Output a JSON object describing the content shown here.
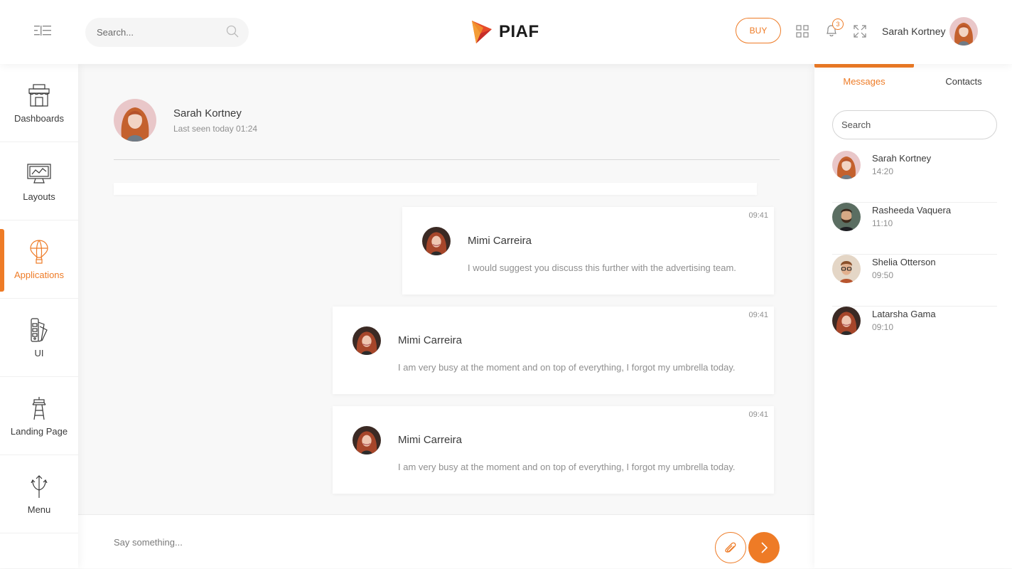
{
  "colors": {
    "accent": "#ee7b26",
    "background": "#f8f8f8"
  },
  "header": {
    "search_placeholder": "Search...",
    "brand": "PIAF",
    "buy_label": "BUY",
    "notification_count": "3",
    "user_name": "Sarah Kortney",
    "icons": [
      "menu-toggle-icon",
      "search-icon",
      "apps-grid-icon",
      "bell-icon",
      "fullscreen-icon"
    ]
  },
  "sidebar": {
    "items": [
      {
        "label": "Dashboards",
        "icon": "shop-icon"
      },
      {
        "label": "Layouts",
        "icon": "monitor-chart-icon"
      },
      {
        "label": "Applications",
        "icon": "air-balloon-icon",
        "active": true
      },
      {
        "label": "UI",
        "icon": "pantone-icon"
      },
      {
        "label": "Landing Page",
        "icon": "tower-icon"
      },
      {
        "label": "Menu",
        "icon": "three-arrows-icon"
      }
    ]
  },
  "chat": {
    "contact_name": "Sarah Kortney",
    "last_seen": "Last seen today 01:24",
    "messages": [
      {
        "sender": "Mimi Carreira",
        "time": "09:41",
        "text": "I would suggest you discuss this further with the advertising team."
      },
      {
        "sender": "Mimi Carreira",
        "time": "09:41",
        "text": "I am very busy at the moment and on top of everything, I forgot my umbrella today."
      },
      {
        "sender": "Mimi Carreira",
        "time": "09:41",
        "text": "I am very busy at the moment and on top of everything, I forgot my umbrella today."
      }
    ],
    "composer_placeholder": "Say something..."
  },
  "right_panel": {
    "tabs": [
      {
        "label": "Messages",
        "active": true
      },
      {
        "label": "Contacts",
        "active": false
      }
    ],
    "search_placeholder": "Search",
    "contacts": [
      {
        "name": "Sarah Kortney",
        "time": "14:20"
      },
      {
        "name": "Rasheeda Vaquera",
        "time": "11:10"
      },
      {
        "name": "Shelia Otterson",
        "time": "09:50"
      },
      {
        "name": "Latarsha Gama",
        "time": "09:10"
      }
    ]
  }
}
